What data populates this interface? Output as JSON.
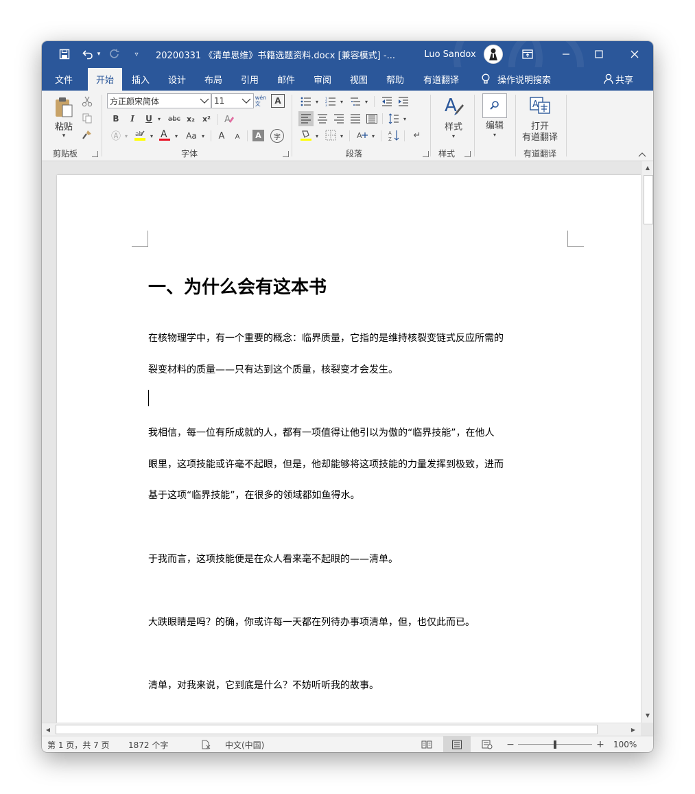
{
  "titlebar": {
    "document_title": "20200331 《清单思维》书籍选题资料.docx [兼容模式] -...",
    "user_name": "Luo Sandox",
    "icons": [
      "save-icon",
      "undo-icon",
      "redo-icon",
      "customize-quick-access-icon",
      "ribbon-display-options-icon",
      "minimize-icon",
      "maximize-icon",
      "close-icon"
    ]
  },
  "tabs": [
    {
      "label": "文件"
    },
    {
      "label": "开始"
    },
    {
      "label": "插入"
    },
    {
      "label": "设计"
    },
    {
      "label": "布局"
    },
    {
      "label": "引用"
    },
    {
      "label": "邮件"
    },
    {
      "label": "审阅"
    },
    {
      "label": "视图"
    },
    {
      "label": "帮助"
    },
    {
      "label": "有道翻译"
    }
  ],
  "active_tab": "开始",
  "tell_me": "操作说明搜索",
  "share": "共享",
  "ribbon": {
    "clipboard": {
      "paste_label": "粘贴",
      "group_label": "剪贴板"
    },
    "font": {
      "font_name": "方正颜宋简体",
      "font_size": "11",
      "phonetic_guide": "wén\n文",
      "bold": "B",
      "italic": "I",
      "underline": "U",
      "strikethrough": "abc",
      "subscript": "x₂",
      "superscript": "x²",
      "change_case": "Aa",
      "grow": "A",
      "shrink": "A",
      "char_shading": "A",
      "enclose": "字",
      "group_label": "字体",
      "highlight_color": "#ffff00",
      "font_color": "#e81123"
    },
    "paragraph": {
      "group_label": "段落"
    },
    "styles": {
      "label": "样式",
      "group_label": "样式"
    },
    "editing": {
      "label": "编辑"
    },
    "youdao": {
      "open_label": "打开",
      "open_label2": "有道翻译",
      "group_label": "有道翻译"
    }
  },
  "document": {
    "heading": "一、为什么会有这本书",
    "paragraphs": [
      "在核物理学中，有一个重要的概念：临界质量，它指的是维持核裂变链式反应所需的",
      "裂变材料的质量——只有达到这个质量，核裂变才会发生。",
      "我相信，每一位有所成就的人，都有一项值得让他引以为傲的“临界技能”，在他人",
      "眼里，这项技能或许毫不起眼，但是，他却能够将这项技能的力量发挥到极致，进而",
      "基于这项“临界技能”，在很多的领域都如鱼得水。",
      "于我而言，这项技能便是在众人看来毫不起眼的——清单。",
      "大跌眼睛是吗？的确，你或许每一天都在列待办事项清单，但，也仅此而已。",
      "清单，对我来说，它到底是什么？不妨听听我的故事。"
    ]
  },
  "status": {
    "page": "第 1 页，共 7 页",
    "words": "1872 个字",
    "language": "中文(中国)",
    "zoom_minus": "−",
    "zoom_plus": "+",
    "zoom": "100%",
    "zoom_level_fraction": 0.5
  },
  "colors": {
    "accent": "#2b579a"
  }
}
